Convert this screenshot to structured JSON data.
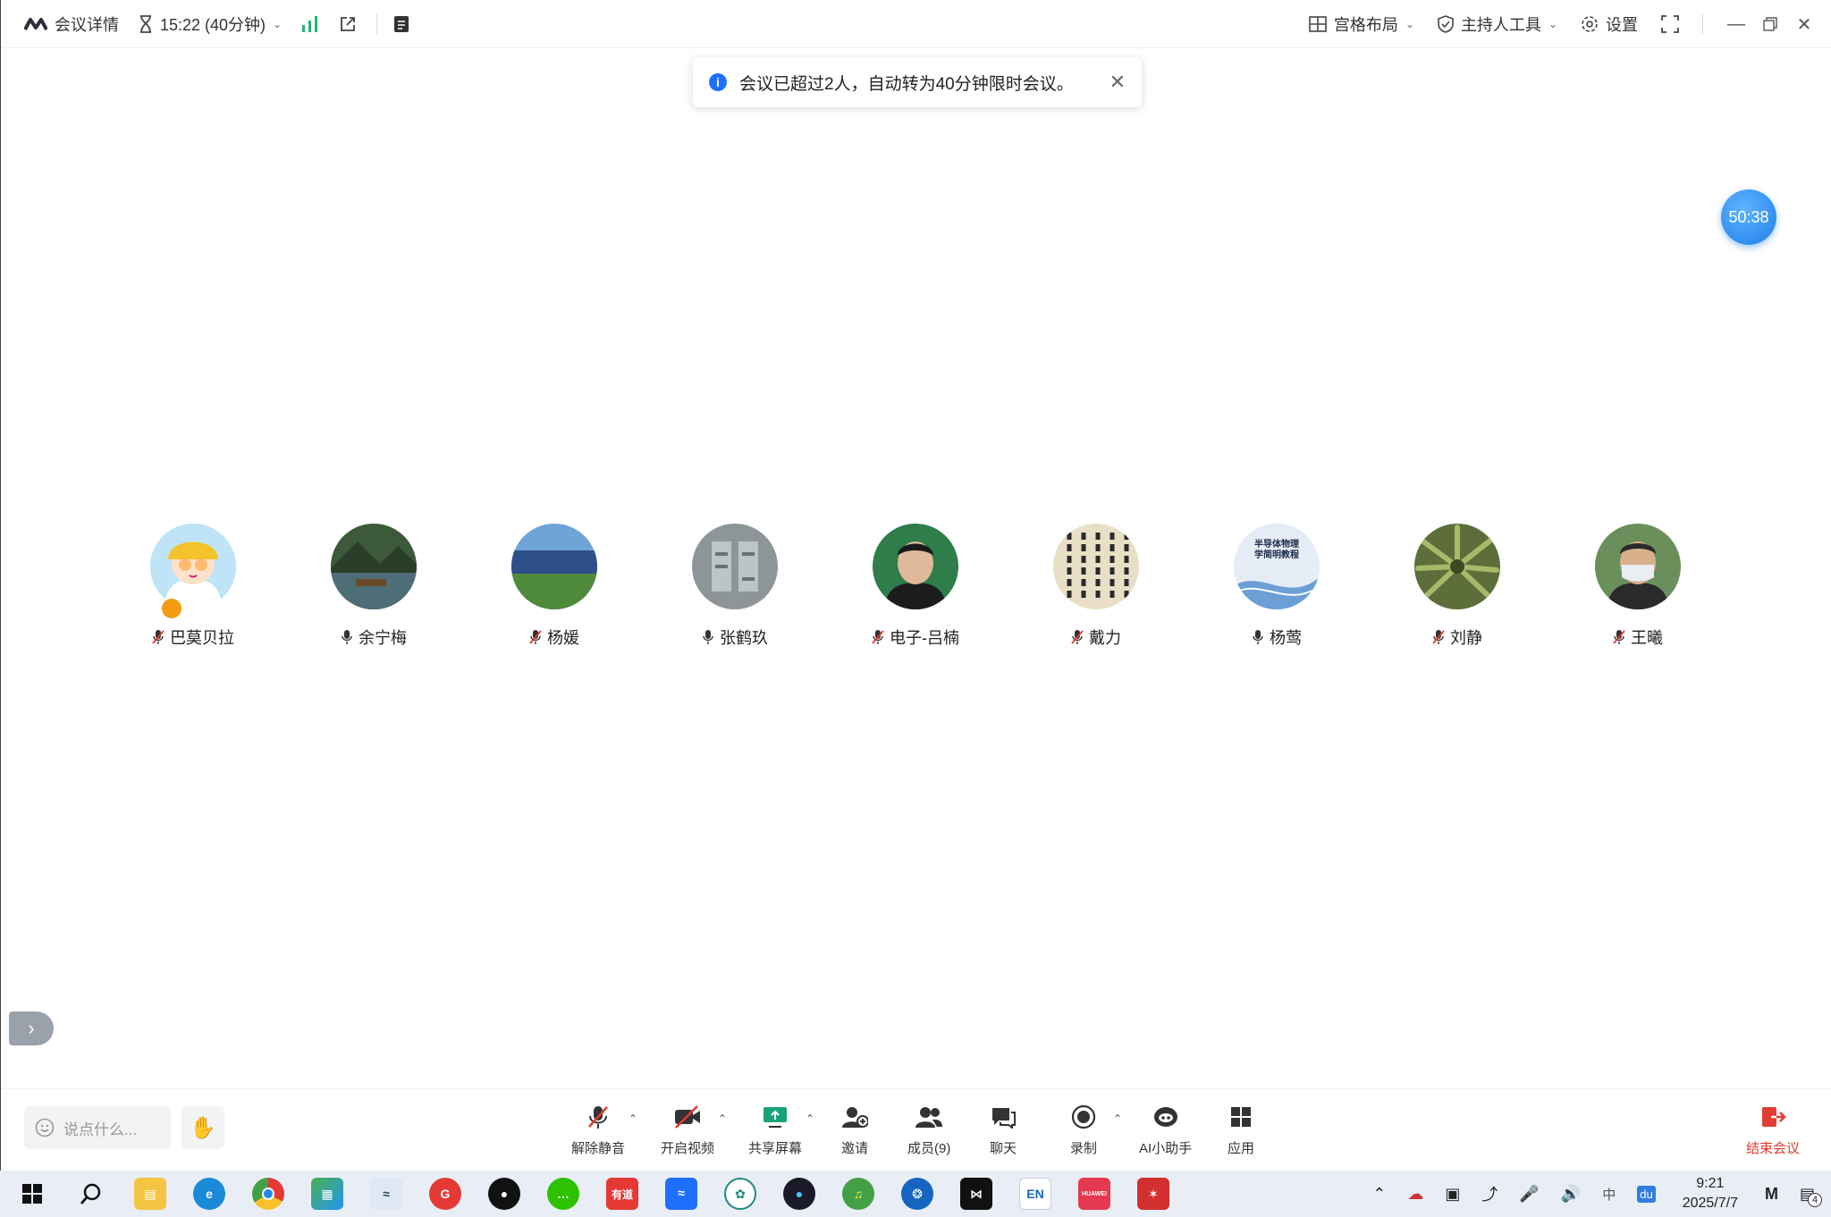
{
  "topbar": {
    "details_label": "会议详情",
    "time_label": "15:22 (40分钟)",
    "layout_label": "宫格布局",
    "host_tools_label": "主持人工具",
    "settings_label": "设置"
  },
  "notice": {
    "text": "会议已超过2人，自动转为40分钟限时会议。"
  },
  "timer": "50:38",
  "participants": [
    {
      "name": "巴莫贝拉",
      "mic": "muted"
    },
    {
      "name": "余宁梅",
      "mic": "on"
    },
    {
      "name": "杨媛",
      "mic": "muted"
    },
    {
      "name": "张鹤玖",
      "mic": "on"
    },
    {
      "name": "电子-吕楠",
      "mic": "muted"
    },
    {
      "name": "戴力",
      "mic": "muted"
    },
    {
      "name": "杨莺",
      "mic": "on"
    },
    {
      "name": "刘静",
      "mic": "muted"
    },
    {
      "name": "王曦",
      "mic": "muted"
    }
  ],
  "avatar_texts": {
    "yangying_book": "半导体物理学简明教程"
  },
  "toolbar": {
    "say_placeholder": "说点什么...",
    "unmute": "解除静音",
    "start_video": "开启视频",
    "share_screen": "共享屏幕",
    "invite": "邀请",
    "members": "成员(9)",
    "chat": "聊天",
    "record": "录制",
    "ai_assistant": "AI小助手",
    "apps": "应用",
    "end_meeting": "结束会议"
  },
  "taskbar": {
    "youdao_label": "有道",
    "en_label": "EN",
    "huawei_label": "HUAWEI",
    "baidu_label": "du",
    "ime_label": "中",
    "clock_time": "9:21",
    "clock_date": "2025/7/7",
    "notification_count": "4"
  },
  "colors": {
    "accent_blue": "#1f6fff",
    "end_red": "#e03c31",
    "share_green": "#1aa37a",
    "signal_green": "#22b573"
  }
}
